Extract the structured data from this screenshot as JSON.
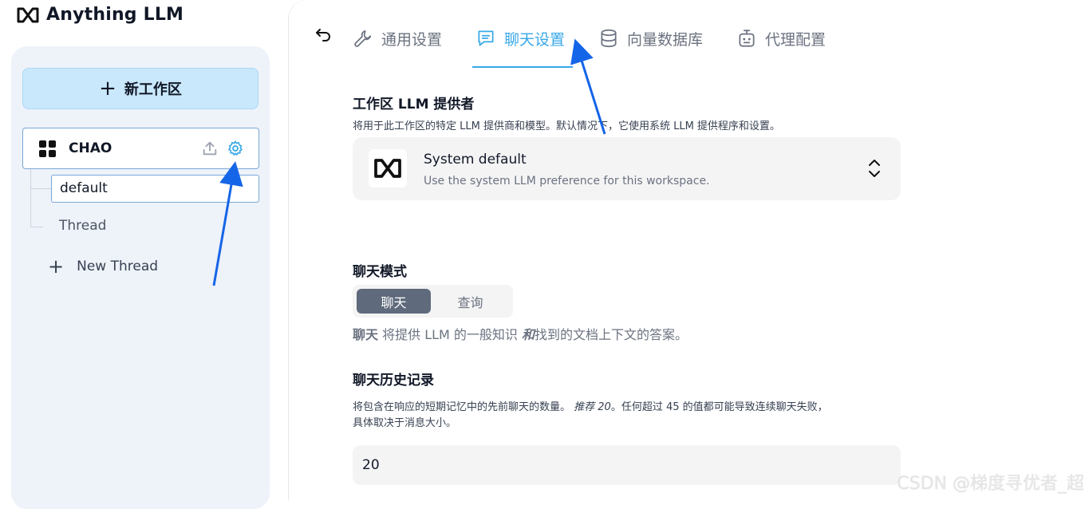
{
  "app": {
    "brand_name": "Anything LLM",
    "brand_icon": "anythingllm-logo-icon"
  },
  "sidebar": {
    "new_workspace_label": "新工作区",
    "workspace": {
      "name": "CHAO",
      "icons": [
        "upload-icon",
        "gear-icon"
      ]
    },
    "threads": [
      {
        "label": "default",
        "active": true
      },
      {
        "label": "Thread",
        "active": false
      }
    ],
    "new_thread_label": "New Thread"
  },
  "tabs": [
    {
      "label": "通用设置",
      "icon": "wrench-icon",
      "active": false
    },
    {
      "label": "聊天设置",
      "icon": "chat-icon",
      "active": true
    },
    {
      "label": "向量数据库",
      "icon": "database-icon",
      "active": false
    },
    {
      "label": "代理配置",
      "icon": "robot-icon",
      "active": false
    }
  ],
  "llm_provider": {
    "title": "工作区 LLM 提供者",
    "desc": "将用于此工作区的特定 LLM 提供商和模型。默认情况下，它使用系统 LLM 提供程序和设置。",
    "selected_name": "System default",
    "selected_desc": "Use the system LLM preference for this workspace."
  },
  "chat_mode": {
    "title": "聊天模式",
    "options": [
      "聊天",
      "查询"
    ],
    "selected": "聊天",
    "desc_bold": "聊天",
    "desc_text1": " 将提供 LLM 的一般知识 ",
    "desc_italic": "和",
    "desc_text2": "找到的文档上下文的答案。"
  },
  "chat_history": {
    "title": "聊天历史记录",
    "desc_part1": "将包含在响应的短期记忆中的先前聊天的数量。",
    "desc_italic": "推荐 20",
    "desc_part2": "。任何超过 45 的值都可能导致连续聊天失败，",
    "desc_line2": "具体取决于消息大小。",
    "value": "20"
  },
  "watermark": "CSDN @梯度寻优者_超",
  "colors": {
    "accent": "#38a8e8",
    "annotation_arrow": "#1565e8",
    "new_workspace_bg": "#c9e8fb"
  }
}
